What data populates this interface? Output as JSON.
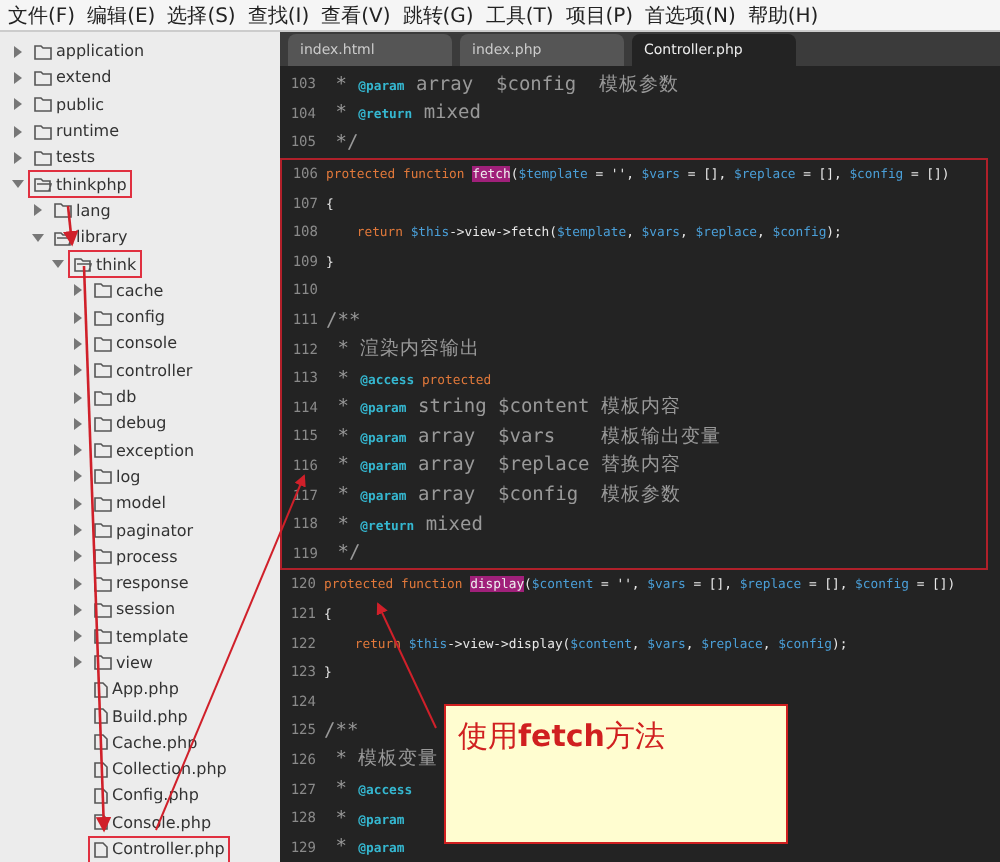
{
  "menu": [
    "文件(F)",
    "编辑(E)",
    "选择(S)",
    "查找(I)",
    "查看(V)",
    "跳转(G)",
    "工具(T)",
    "项目(P)",
    "首选项(N)",
    "帮助(H)"
  ],
  "sidebar": {
    "items": [
      {
        "label": "application",
        "kind": "folder",
        "expanded": false,
        "highlighted": false
      },
      {
        "label": "extend",
        "kind": "folder",
        "expanded": false,
        "highlighted": false
      },
      {
        "label": "public",
        "kind": "folder",
        "expanded": false,
        "highlighted": false
      },
      {
        "label": "runtime",
        "kind": "folder",
        "expanded": false,
        "highlighted": false
      },
      {
        "label": "tests",
        "kind": "folder",
        "expanded": false,
        "highlighted": false
      },
      {
        "label": "thinkphp",
        "kind": "folder",
        "expanded": true,
        "highlighted": true,
        "children": [
          {
            "label": "lang",
            "kind": "folder",
            "expanded": false,
            "highlighted": false
          },
          {
            "label": "library",
            "kind": "folder",
            "expanded": true,
            "highlighted": false,
            "children": [
              {
                "label": "think",
                "kind": "folder",
                "expanded": true,
                "highlighted": true,
                "children": [
                  {
                    "label": "cache",
                    "kind": "folder",
                    "expanded": false,
                    "highlighted": false
                  },
                  {
                    "label": "config",
                    "kind": "folder",
                    "expanded": false,
                    "highlighted": false
                  },
                  {
                    "label": "console",
                    "kind": "folder",
                    "expanded": false,
                    "highlighted": false
                  },
                  {
                    "label": "controller",
                    "kind": "folder",
                    "expanded": false,
                    "highlighted": false
                  },
                  {
                    "label": "db",
                    "kind": "folder",
                    "expanded": false,
                    "highlighted": false
                  },
                  {
                    "label": "debug",
                    "kind": "folder",
                    "expanded": false,
                    "highlighted": false
                  },
                  {
                    "label": "exception",
                    "kind": "folder",
                    "expanded": false,
                    "highlighted": false
                  },
                  {
                    "label": "log",
                    "kind": "folder",
                    "expanded": false,
                    "highlighted": false
                  },
                  {
                    "label": "model",
                    "kind": "folder",
                    "expanded": false,
                    "highlighted": false
                  },
                  {
                    "label": "paginator",
                    "kind": "folder",
                    "expanded": false,
                    "highlighted": false
                  },
                  {
                    "label": "process",
                    "kind": "folder",
                    "expanded": false,
                    "highlighted": false
                  },
                  {
                    "label": "response",
                    "kind": "folder",
                    "expanded": false,
                    "highlighted": false
                  },
                  {
                    "label": "session",
                    "kind": "folder",
                    "expanded": false,
                    "highlighted": false
                  },
                  {
                    "label": "template",
                    "kind": "folder",
                    "expanded": false,
                    "highlighted": false
                  },
                  {
                    "label": "view",
                    "kind": "folder",
                    "expanded": false,
                    "highlighted": false
                  },
                  {
                    "label": "App.php",
                    "kind": "file",
                    "highlighted": false
                  },
                  {
                    "label": "Build.php",
                    "kind": "file",
                    "highlighted": false
                  },
                  {
                    "label": "Cache.php",
                    "kind": "file",
                    "highlighted": false
                  },
                  {
                    "label": "Collection.php",
                    "kind": "file",
                    "highlighted": false
                  },
                  {
                    "label": "Config.php",
                    "kind": "file",
                    "highlighted": false
                  },
                  {
                    "label": "Console.php",
                    "kind": "file",
                    "highlighted": false
                  },
                  {
                    "label": "Controller.php",
                    "kind": "file",
                    "highlighted": true
                  }
                ]
              }
            ]
          }
        ]
      }
    ]
  },
  "tabs": [
    {
      "label": "index.html",
      "selected": false
    },
    {
      "label": "index.php",
      "selected": false
    },
    {
      "label": "Controller.php",
      "selected": true
    }
  ],
  "code": [
    {
      "number": "103",
      "boxed": false,
      "tokens": [
        {
          "text": " * ",
          "kind": "comment"
        },
        {
          "text": "@param",
          "kind": "tag"
        },
        {
          "text": " array  $config  模板参数",
          "kind": "comment"
        }
      ]
    },
    {
      "number": "104",
      "boxed": false,
      "tokens": [
        {
          "text": " * ",
          "kind": "comment"
        },
        {
          "text": "@return",
          "kind": "tag"
        },
        {
          "text": " mixed",
          "kind": "comment"
        }
      ]
    },
    {
      "number": "105",
      "boxed": false,
      "tokens": [
        {
          "text": " */",
          "kind": "comment"
        }
      ]
    },
    {
      "number": "106",
      "boxed": true,
      "tokens": [
        {
          "text": "protected function ",
          "kind": "keyword"
        },
        {
          "text": "fetch",
          "kind": "match"
        },
        {
          "text": "(",
          "kind": "plain"
        },
        {
          "text": "$template",
          "kind": "var"
        },
        {
          "text": " = '', ",
          "kind": "plain"
        },
        {
          "text": "$vars",
          "kind": "var"
        },
        {
          "text": " = [], ",
          "kind": "plain"
        },
        {
          "text": "$replace",
          "kind": "var"
        },
        {
          "text": " = [], ",
          "kind": "plain"
        },
        {
          "text": "$config",
          "kind": "var"
        },
        {
          "text": " = [])",
          "kind": "plain"
        }
      ]
    },
    {
      "number": "107",
      "boxed": true,
      "tokens": [
        {
          "text": "{",
          "kind": "plain"
        }
      ]
    },
    {
      "number": "108",
      "boxed": true,
      "tokens": [
        {
          "text": "    return ",
          "kind": "keyword"
        },
        {
          "text": "$this",
          "kind": "var"
        },
        {
          "text": "->view->fetch(",
          "kind": "plain"
        },
        {
          "text": "$template",
          "kind": "var"
        },
        {
          "text": ", ",
          "kind": "plain"
        },
        {
          "text": "$vars",
          "kind": "var"
        },
        {
          "text": ", ",
          "kind": "plain"
        },
        {
          "text": "$replace",
          "kind": "var"
        },
        {
          "text": ", ",
          "kind": "plain"
        },
        {
          "text": "$config",
          "kind": "var"
        },
        {
          "text": ");",
          "kind": "plain"
        }
      ]
    },
    {
      "number": "109",
      "boxed": true,
      "tokens": [
        {
          "text": "}",
          "kind": "plain"
        }
      ]
    },
    {
      "number": "110",
      "boxed": true
    },
    {
      "number": "111",
      "boxed": true,
      "tokens": [
        {
          "text": "/**",
          "kind": "comment"
        }
      ]
    },
    {
      "number": "112",
      "boxed": true,
      "tokens": [
        {
          "text": " * 渲染内容输出",
          "kind": "comment"
        }
      ]
    },
    {
      "number": "113",
      "boxed": true,
      "tokens": [
        {
          "text": " * ",
          "kind": "comment"
        },
        {
          "text": "@access",
          "kind": "tag"
        },
        {
          "text": " protected",
          "kind": "keyword"
        }
      ]
    },
    {
      "number": "114",
      "boxed": true,
      "tokens": [
        {
          "text": " * ",
          "kind": "comment"
        },
        {
          "text": "@param",
          "kind": "tag"
        },
        {
          "text": " string $content 模板内容",
          "kind": "comment"
        }
      ]
    },
    {
      "number": "115",
      "boxed": true,
      "tokens": [
        {
          "text": " * ",
          "kind": "comment"
        },
        {
          "text": "@param",
          "kind": "tag"
        },
        {
          "text": " array  $vars    模板输出变量",
          "kind": "comment"
        }
      ]
    },
    {
      "number": "116",
      "boxed": true,
      "tokens": [
        {
          "text": " * ",
          "kind": "comment"
        },
        {
          "text": "@param",
          "kind": "tag"
        },
        {
          "text": " array  $replace 替换内容",
          "kind": "comment"
        }
      ]
    },
    {
      "number": "117",
      "boxed": true,
      "tokens": [
        {
          "text": " * ",
          "kind": "comment"
        },
        {
          "text": "@param",
          "kind": "tag"
        },
        {
          "text": " array  $config  模板参数",
          "kind": "comment"
        }
      ]
    },
    {
      "number": "118",
      "boxed": true,
      "tokens": [
        {
          "text": " * ",
          "kind": "comment"
        },
        {
          "text": "@return",
          "kind": "tag"
        },
        {
          "text": " mixed",
          "kind": "comment"
        }
      ]
    },
    {
      "number": "119",
      "boxed": true,
      "tokens": [
        {
          "text": " */",
          "kind": "comment"
        }
      ]
    },
    {
      "number": "120",
      "boxed": false,
      "tokens": [
        {
          "text": "protected function ",
          "kind": "keyword"
        },
        {
          "text": "display",
          "kind": "match"
        },
        {
          "text": "(",
          "kind": "plain"
        },
        {
          "text": "$content",
          "kind": "var"
        },
        {
          "text": " = '', ",
          "kind": "plain"
        },
        {
          "text": "$vars",
          "kind": "var"
        },
        {
          "text": " = [], ",
          "kind": "plain"
        },
        {
          "text": "$replace",
          "kind": "var"
        },
        {
          "text": " = [], ",
          "kind": "plain"
        },
        {
          "text": "$config",
          "kind": "var"
        },
        {
          "text": " = [])",
          "kind": "plain"
        }
      ]
    },
    {
      "number": "121",
      "boxed": false,
      "tokens": [
        {
          "text": "{",
          "kind": "plain"
        }
      ]
    },
    {
      "number": "122",
      "boxed": false,
      "tokens": [
        {
          "text": "    return ",
          "kind": "keyword"
        },
        {
          "text": "$this",
          "kind": "var"
        },
        {
          "text": "->view->display(",
          "kind": "plain"
        },
        {
          "text": "$content",
          "kind": "var"
        },
        {
          "text": ", ",
          "kind": "plain"
        },
        {
          "text": "$vars",
          "kind": "var"
        },
        {
          "text": ", ",
          "kind": "plain"
        },
        {
          "text": "$replace",
          "kind": "var"
        },
        {
          "text": ", ",
          "kind": "plain"
        },
        {
          "text": "$config",
          "kind": "var"
        },
        {
          "text": ");",
          "kind": "plain"
        }
      ]
    },
    {
      "number": "123",
      "boxed": false,
      "tokens": [
        {
          "text": "}",
          "kind": "plain"
        }
      ]
    },
    {
      "number": "124",
      "boxed": false
    },
    {
      "number": "125",
      "boxed": false,
      "tokens": [
        {
          "text": "/**",
          "kind": "comment"
        }
      ]
    },
    {
      "number": "126",
      "boxed": false,
      "tokens": [
        {
          "text": " * 模板变量",
          "kind": "comment"
        }
      ]
    },
    {
      "number": "127",
      "boxed": false,
      "tokens": [
        {
          "text": " * ",
          "kind": "comment"
        },
        {
          "text": "@access",
          "kind": "tag"
        }
      ]
    },
    {
      "number": "128",
      "boxed": false,
      "tokens": [
        {
          "text": " * ",
          "kind": "comment"
        },
        {
          "text": "@param",
          "kind": "tag"
        }
      ]
    },
    {
      "number": "129",
      "boxed": false,
      "tokens": [
        {
          "text": " * ",
          "kind": "comment"
        },
        {
          "text": "@param",
          "kind": "tag"
        }
      ]
    }
  ],
  "callout": {
    "text": "使用**fetch**方法"
  }
}
